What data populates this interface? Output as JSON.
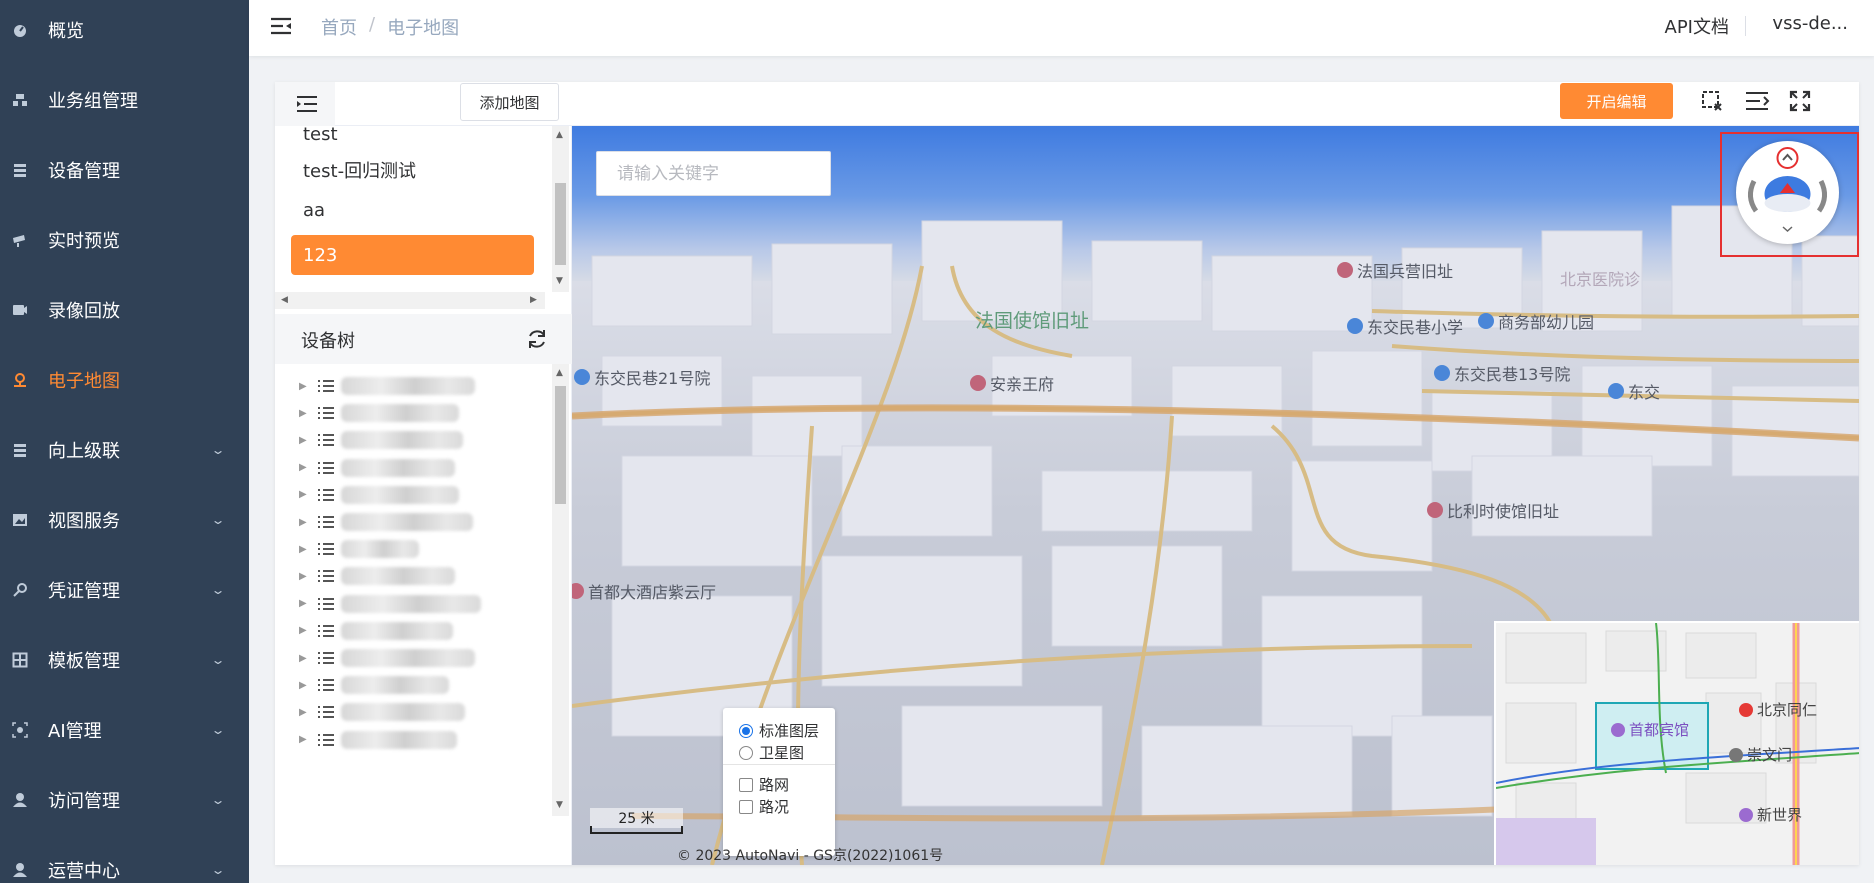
{
  "sidebar": {
    "items": [
      {
        "label": "概览",
        "icon": "dashboard-icon",
        "expandable": false,
        "active": false
      },
      {
        "label": "业务组管理",
        "icon": "group-icon",
        "expandable": false,
        "active": false
      },
      {
        "label": "设备管理",
        "icon": "device-icon",
        "expandable": false,
        "active": false
      },
      {
        "label": "实时预览",
        "icon": "live-icon",
        "expandable": false,
        "active": false
      },
      {
        "label": "录像回放",
        "icon": "playback-icon",
        "expandable": false,
        "active": false
      },
      {
        "label": "电子地图",
        "icon": "map-pin-icon",
        "expandable": false,
        "active": true
      },
      {
        "label": "向上级联",
        "icon": "cascade-icon",
        "expandable": true,
        "active": false
      },
      {
        "label": "视图服务",
        "icon": "image-icon",
        "expandable": true,
        "active": false
      },
      {
        "label": "凭证管理",
        "icon": "key-icon",
        "expandable": true,
        "active": false
      },
      {
        "label": "模板管理",
        "icon": "template-icon",
        "expandable": true,
        "active": false
      },
      {
        "label": "AI管理",
        "icon": "ai-icon",
        "expandable": true,
        "active": false
      },
      {
        "label": "访问管理",
        "icon": "user-icon",
        "expandable": true,
        "active": false
      },
      {
        "label": "运营中心",
        "icon": "operation-icon",
        "expandable": true,
        "active": false
      }
    ]
  },
  "header": {
    "breadcrumb": [
      "首页",
      "电子地图"
    ],
    "breadcrumb_sep": "/",
    "api_doc": "API文档",
    "user": "vss-de..."
  },
  "toolbar": {
    "add_map": "添加地图",
    "start_edit": "开启编辑",
    "accent": "#ff8a33"
  },
  "map_list": {
    "items": [
      "test",
      "test-回归测试",
      "aa",
      "123"
    ],
    "selected": "123"
  },
  "device_tree": {
    "title": "设备树",
    "row_count": 14
  },
  "map": {
    "search_placeholder": "请输入关键字",
    "pois": [
      {
        "label": "法国兵营旧址"
      },
      {
        "label": "北京医院诊"
      },
      {
        "label": "法国使馆旧址"
      },
      {
        "label": "东交民巷小学"
      },
      {
        "label": "商务部幼儿园"
      },
      {
        "label": "东交民巷21号院"
      },
      {
        "label": "安亲王府"
      },
      {
        "label": "东交民巷13号院"
      },
      {
        "label": "东交"
      },
      {
        "label": "比利时使馆旧址"
      },
      {
        "label": "首都大酒店紫云厅"
      }
    ],
    "layers": {
      "standard": "标准图层",
      "satellite": "卫星图",
      "road_net": "路网",
      "traffic": "路况",
      "selected_base": "standard"
    },
    "scale": "25 米",
    "copyright": "© 2023 AutoNavi - GS京(2022)1061号",
    "overview_pois": [
      {
        "label": "首都宾馆"
      },
      {
        "label": "北京同仁"
      },
      {
        "label": "崇文门"
      },
      {
        "label": "新世界"
      }
    ]
  }
}
